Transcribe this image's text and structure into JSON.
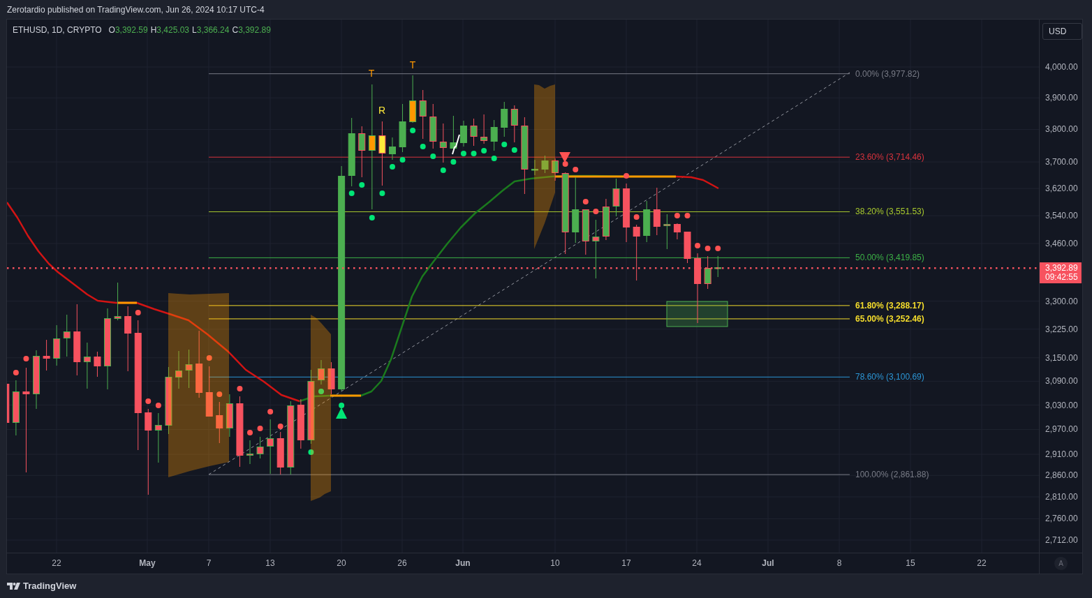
{
  "header": {
    "text": "Zerotardio published on TradingView.com, Jun 26, 2024 10:17 UTC-4"
  },
  "legend": {
    "symbol": "ETHUSD, 1D, CRYPTO",
    "values": [
      {
        "label": "O",
        "value": "3,392.59"
      },
      {
        "label": "H",
        "value": "3,425.03"
      },
      {
        "label": "L",
        "value": "3,366.24"
      },
      {
        "label": "C",
        "value": "3,392.89"
      }
    ]
  },
  "currency_button": {
    "label": "USD"
  },
  "price_axis": {
    "labels": [
      "4,000.00",
      "3,900.00",
      "3,800.00",
      "3,700.00",
      "3,620.00",
      "3,540.00",
      "3,460.00",
      "3,300.00",
      "3,225.00",
      "3,150.00",
      "3,090.00",
      "3,030.00",
      "2,970.00",
      "2,910.00",
      "2,860.00",
      "2,810.00",
      "2,760.00",
      "2,712.00"
    ]
  },
  "last_price": {
    "price": "3,392.89",
    "countdown": "09:42:55"
  },
  "fib_levels": [
    {
      "label": "0.00% (3,977.82)",
      "color": "#787b86",
      "bold": false
    },
    {
      "label": "23.60% (3,714.46)",
      "color": "#d8333d",
      "bold": false
    },
    {
      "label": "38.20% (3,551.53)",
      "color": "#a8c92e",
      "bold": false
    },
    {
      "label": "50.00% (3,419.85)",
      "color": "#3cb046",
      "bold": false
    },
    {
      "label": "61.80% (3,288.17)",
      "color": "#f5dd2c",
      "bold": true
    },
    {
      "label": "65.00% (3,252.46)",
      "color": "#f5dd2c",
      "bold": true
    },
    {
      "label": "78.60% (3,100.69)",
      "color": "#2c96d6",
      "bold": false
    },
    {
      "label": "100.00% (2,861.88)",
      "color": "#787b86",
      "bold": false
    }
  ],
  "annotations": [
    {
      "text": "T",
      "color": "#ff9800"
    },
    {
      "text": "T",
      "color": "#ff9800"
    },
    {
      "text": "R",
      "color": "#ffeb3b"
    }
  ],
  "time_axis": {
    "labels": [
      {
        "text": "22",
        "kind": "day"
      },
      {
        "text": "May",
        "kind": "month"
      },
      {
        "text": "7",
        "kind": "day"
      },
      {
        "text": "13",
        "kind": "day"
      },
      {
        "text": "20",
        "kind": "day"
      },
      {
        "text": "26",
        "kind": "day"
      },
      {
        "text": "Jun",
        "kind": "month"
      },
      {
        "text": "10",
        "kind": "day"
      },
      {
        "text": "17",
        "kind": "day"
      },
      {
        "text": "24",
        "kind": "day"
      },
      {
        "text": "Jul",
        "kind": "month"
      },
      {
        "text": "8",
        "kind": "day"
      },
      {
        "text": "15",
        "kind": "day"
      },
      {
        "text": "22",
        "kind": "day"
      }
    ]
  },
  "auto_scale_button": {
    "label": "A"
  },
  "footer": {
    "brand": "TradingView"
  }
}
